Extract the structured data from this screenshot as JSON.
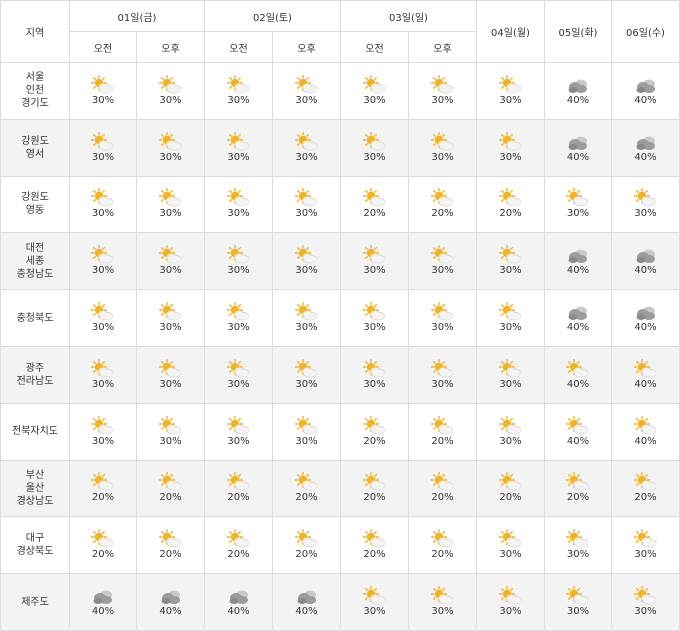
{
  "header": {
    "region_label": "지역",
    "days": [
      "01일(금)",
      "02일(토)",
      "03일(일)",
      "04일(월)",
      "05일(화)",
      "06일(수)"
    ],
    "am_label": "오전",
    "pm_label": "오후"
  },
  "rows": [
    {
      "region": [
        "서울",
        "인천",
        "경기도"
      ],
      "cells": [
        {
          "icon": "partly-cloudy-icon",
          "pct": "30%"
        },
        {
          "icon": "partly-cloudy-icon",
          "pct": "30%"
        },
        {
          "icon": "partly-cloudy-icon",
          "pct": "30%"
        },
        {
          "icon": "partly-cloudy-icon",
          "pct": "30%"
        },
        {
          "icon": "partly-cloudy-icon",
          "pct": "30%"
        },
        {
          "icon": "partly-cloudy-icon",
          "pct": "30%"
        },
        {
          "icon": "partly-cloudy-icon",
          "pct": "30%"
        },
        {
          "icon": "cloudy-icon",
          "pct": "40%"
        },
        {
          "icon": "cloudy-icon",
          "pct": "40%"
        }
      ]
    },
    {
      "region": [
        "강원도",
        "영서"
      ],
      "cells": [
        {
          "icon": "partly-cloudy-icon",
          "pct": "30%"
        },
        {
          "icon": "partly-cloudy-icon",
          "pct": "30%"
        },
        {
          "icon": "partly-cloudy-icon",
          "pct": "30%"
        },
        {
          "icon": "partly-cloudy-icon",
          "pct": "30%"
        },
        {
          "icon": "partly-cloudy-icon",
          "pct": "30%"
        },
        {
          "icon": "partly-cloudy-icon",
          "pct": "30%"
        },
        {
          "icon": "partly-cloudy-icon",
          "pct": "30%"
        },
        {
          "icon": "cloudy-icon",
          "pct": "40%"
        },
        {
          "icon": "cloudy-icon",
          "pct": "40%"
        }
      ]
    },
    {
      "region": [
        "강원도",
        "영동"
      ],
      "cells": [
        {
          "icon": "partly-cloudy-icon",
          "pct": "30%"
        },
        {
          "icon": "partly-cloudy-icon",
          "pct": "30%"
        },
        {
          "icon": "partly-cloudy-icon",
          "pct": "30%"
        },
        {
          "icon": "partly-cloudy-icon",
          "pct": "30%"
        },
        {
          "icon": "partly-cloudy-icon",
          "pct": "20%"
        },
        {
          "icon": "partly-cloudy-icon",
          "pct": "20%"
        },
        {
          "icon": "partly-cloudy-icon",
          "pct": "20%"
        },
        {
          "icon": "partly-cloudy-icon",
          "pct": "30%"
        },
        {
          "icon": "partly-cloudy-icon",
          "pct": "30%"
        }
      ]
    },
    {
      "region": [
        "대전",
        "세종",
        "충청남도"
      ],
      "cells": [
        {
          "icon": "partly-cloudy-icon",
          "pct": "30%"
        },
        {
          "icon": "partly-cloudy-icon",
          "pct": "30%"
        },
        {
          "icon": "partly-cloudy-icon",
          "pct": "30%"
        },
        {
          "icon": "partly-cloudy-icon",
          "pct": "30%"
        },
        {
          "icon": "partly-cloudy-icon",
          "pct": "30%"
        },
        {
          "icon": "partly-cloudy-icon",
          "pct": "30%"
        },
        {
          "icon": "partly-cloudy-icon",
          "pct": "30%"
        },
        {
          "icon": "cloudy-icon",
          "pct": "40%"
        },
        {
          "icon": "cloudy-icon",
          "pct": "40%"
        }
      ]
    },
    {
      "region": [
        "충청북도"
      ],
      "cells": [
        {
          "icon": "partly-cloudy-icon",
          "pct": "30%"
        },
        {
          "icon": "partly-cloudy-icon",
          "pct": "30%"
        },
        {
          "icon": "partly-cloudy-icon",
          "pct": "30%"
        },
        {
          "icon": "partly-cloudy-icon",
          "pct": "30%"
        },
        {
          "icon": "partly-cloudy-icon",
          "pct": "30%"
        },
        {
          "icon": "partly-cloudy-icon",
          "pct": "30%"
        },
        {
          "icon": "partly-cloudy-icon",
          "pct": "30%"
        },
        {
          "icon": "cloudy-icon",
          "pct": "40%"
        },
        {
          "icon": "cloudy-icon",
          "pct": "40%"
        }
      ]
    },
    {
      "region": [
        "광주",
        "전라남도"
      ],
      "cells": [
        {
          "icon": "partly-cloudy-icon",
          "pct": "30%"
        },
        {
          "icon": "partly-cloudy-icon",
          "pct": "30%"
        },
        {
          "icon": "partly-cloudy-icon",
          "pct": "30%"
        },
        {
          "icon": "partly-cloudy-icon",
          "pct": "30%"
        },
        {
          "icon": "partly-cloudy-icon",
          "pct": "30%"
        },
        {
          "icon": "partly-cloudy-icon",
          "pct": "30%"
        },
        {
          "icon": "partly-cloudy-icon",
          "pct": "30%"
        },
        {
          "icon": "partly-cloudy-icon",
          "pct": "40%"
        },
        {
          "icon": "partly-cloudy-icon",
          "pct": "40%"
        }
      ]
    },
    {
      "region": [
        "전북자치도"
      ],
      "cells": [
        {
          "icon": "partly-cloudy-icon",
          "pct": "30%"
        },
        {
          "icon": "partly-cloudy-icon",
          "pct": "30%"
        },
        {
          "icon": "partly-cloudy-icon",
          "pct": "30%"
        },
        {
          "icon": "partly-cloudy-icon",
          "pct": "30%"
        },
        {
          "icon": "partly-cloudy-icon",
          "pct": "20%"
        },
        {
          "icon": "partly-cloudy-icon",
          "pct": "20%"
        },
        {
          "icon": "partly-cloudy-icon",
          "pct": "30%"
        },
        {
          "icon": "partly-cloudy-icon",
          "pct": "40%"
        },
        {
          "icon": "partly-cloudy-icon",
          "pct": "40%"
        }
      ]
    },
    {
      "region": [
        "부산",
        "울산",
        "경상남도"
      ],
      "cells": [
        {
          "icon": "partly-cloudy-icon",
          "pct": "20%"
        },
        {
          "icon": "partly-cloudy-icon",
          "pct": "20%"
        },
        {
          "icon": "partly-cloudy-icon",
          "pct": "20%"
        },
        {
          "icon": "partly-cloudy-icon",
          "pct": "20%"
        },
        {
          "icon": "partly-cloudy-icon",
          "pct": "20%"
        },
        {
          "icon": "partly-cloudy-icon",
          "pct": "20%"
        },
        {
          "icon": "partly-cloudy-icon",
          "pct": "20%"
        },
        {
          "icon": "partly-cloudy-icon",
          "pct": "20%"
        },
        {
          "icon": "partly-cloudy-icon",
          "pct": "20%"
        }
      ]
    },
    {
      "region": [
        "대구",
        "경상북도"
      ],
      "cells": [
        {
          "icon": "partly-cloudy-icon",
          "pct": "20%"
        },
        {
          "icon": "partly-cloudy-icon",
          "pct": "20%"
        },
        {
          "icon": "partly-cloudy-icon",
          "pct": "20%"
        },
        {
          "icon": "partly-cloudy-icon",
          "pct": "20%"
        },
        {
          "icon": "partly-cloudy-icon",
          "pct": "20%"
        },
        {
          "icon": "partly-cloudy-icon",
          "pct": "20%"
        },
        {
          "icon": "partly-cloudy-icon",
          "pct": "30%"
        },
        {
          "icon": "partly-cloudy-icon",
          "pct": "30%"
        },
        {
          "icon": "partly-cloudy-icon",
          "pct": "30%"
        }
      ]
    },
    {
      "region": [
        "제주도"
      ],
      "cells": [
        {
          "icon": "cloudy-icon",
          "pct": "40%"
        },
        {
          "icon": "cloudy-icon",
          "pct": "40%"
        },
        {
          "icon": "cloudy-icon",
          "pct": "40%"
        },
        {
          "icon": "cloudy-icon",
          "pct": "40%"
        },
        {
          "icon": "partly-cloudy-icon",
          "pct": "30%"
        },
        {
          "icon": "partly-cloudy-icon",
          "pct": "30%"
        },
        {
          "icon": "partly-cloudy-icon",
          "pct": "30%"
        },
        {
          "icon": "partly-cloudy-icon",
          "pct": "30%"
        },
        {
          "icon": "partly-cloudy-icon",
          "pct": "30%"
        }
      ]
    }
  ],
  "colors": {
    "shade_row": "#f3f3f3",
    "border": "#dcdcdc",
    "top_border": "#9a9a9a",
    "sun": "#f6b21a",
    "cloud_light": "#f4f4f4",
    "cloud_dark": "#9c9c9c"
  }
}
